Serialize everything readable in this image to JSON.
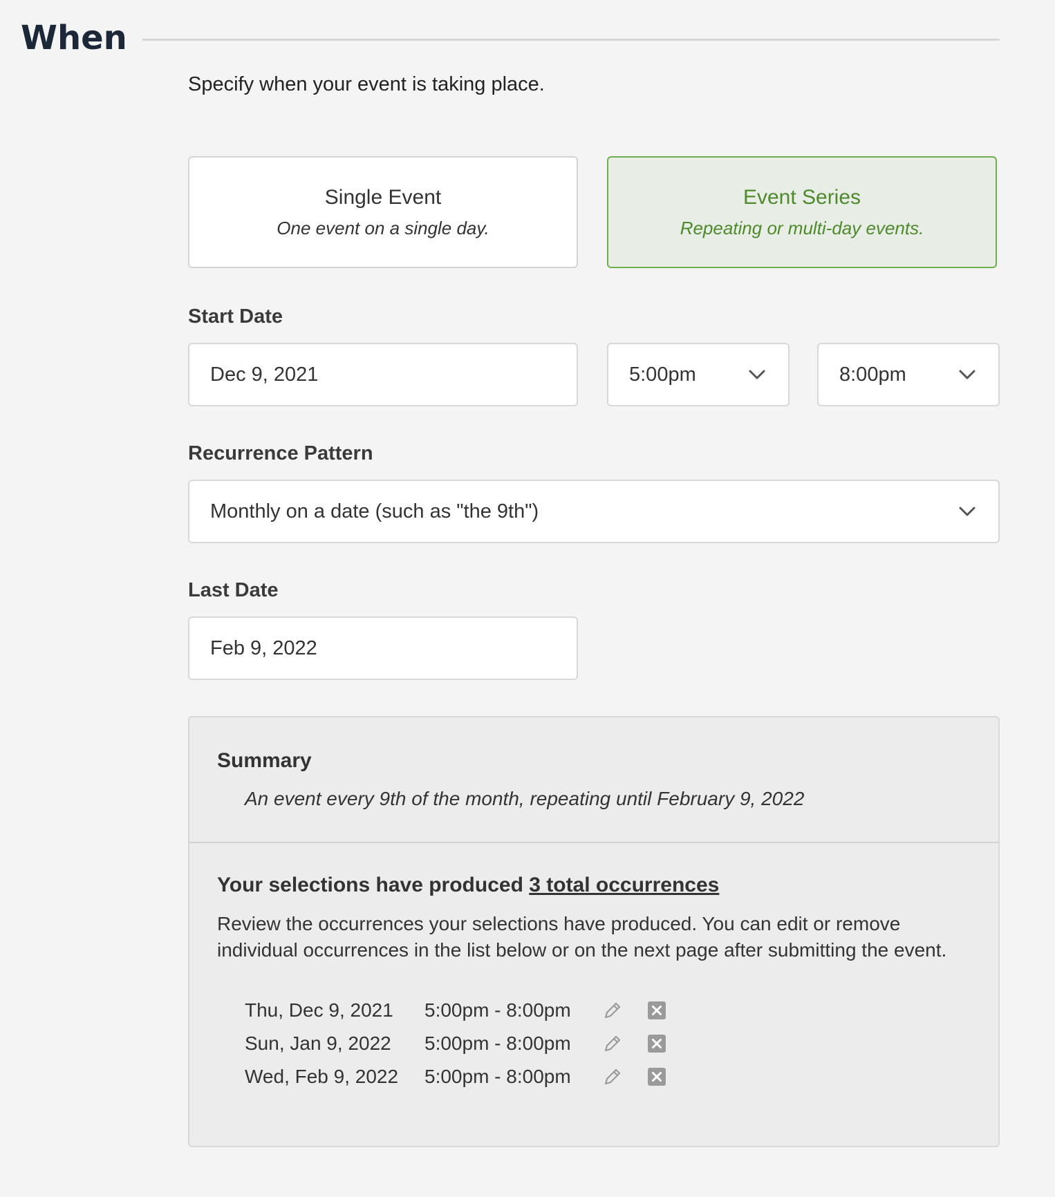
{
  "section": {
    "title": "When",
    "intro": "Specify when your event is taking place."
  },
  "event_type": {
    "selected": "series",
    "single": {
      "title": "Single Event",
      "subtitle": "One event on a single day."
    },
    "series": {
      "title": "Event Series",
      "subtitle": "Repeating or multi-day events."
    }
  },
  "start_date": {
    "label": "Start Date",
    "date": "Dec 9, 2021",
    "start_time": "5:00pm",
    "end_time": "8:00pm"
  },
  "recurrence": {
    "label": "Recurrence Pattern",
    "value": "Monthly on a date (such as \"the 9th\")"
  },
  "last_date": {
    "label": "Last Date",
    "value": "Feb 9, 2022"
  },
  "summary": {
    "heading": "Summary",
    "text": "An event every 9th of the month, repeating until February 9, 2022",
    "produced_prefix": "Your selections have produced ",
    "produced_link": "3 total occurrences",
    "review": "Review the occurrences your selections have produced. You can edit or remove individual occurrences in the list below or on the next page after submitting the event.",
    "occurrences": [
      {
        "date": "Thu, Dec 9, 2021",
        "time": "5:00pm - 8:00pm"
      },
      {
        "date": "Sun, Jan 9, 2022",
        "time": "5:00pm - 8:00pm"
      },
      {
        "date": "Wed, Feb 9, 2022",
        "time": "5:00pm - 8:00pm"
      }
    ]
  },
  "colors": {
    "page_bg": "#f4f4f4",
    "heading": "#1c2837",
    "accent_green": "#4e8a2c",
    "accent_border": "#6fae4f",
    "selected_bg": "#e8eee6",
    "icon_gray": "#9a9a9a"
  },
  "icons": {
    "select_arrow": "chevron-down-icon",
    "edit": "pencil-icon",
    "remove": "close-box-icon"
  }
}
